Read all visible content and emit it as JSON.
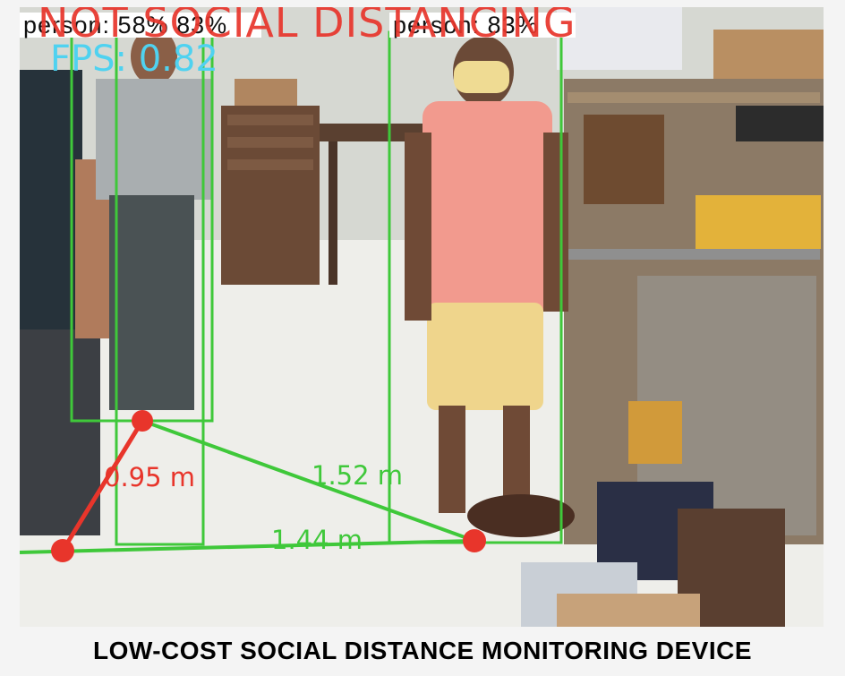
{
  "detections": {
    "left_label": "person: 58% 83%",
    "right_label": "person: 83%"
  },
  "overlay": {
    "status": "NOT SOCIAL DISTANCING",
    "fps": "FPS: 0.82"
  },
  "distances": {
    "red_pair": "0.95 m",
    "green_pair_1": "1.52 m",
    "green_pair_2": "1.44 m"
  },
  "colors": {
    "violation": "#e8352b",
    "safe": "#3fc83a",
    "fps": "#4fd2f0"
  },
  "caption": "LOW-COST SOCIAL DISTANCE MONITORING  DEVICE"
}
